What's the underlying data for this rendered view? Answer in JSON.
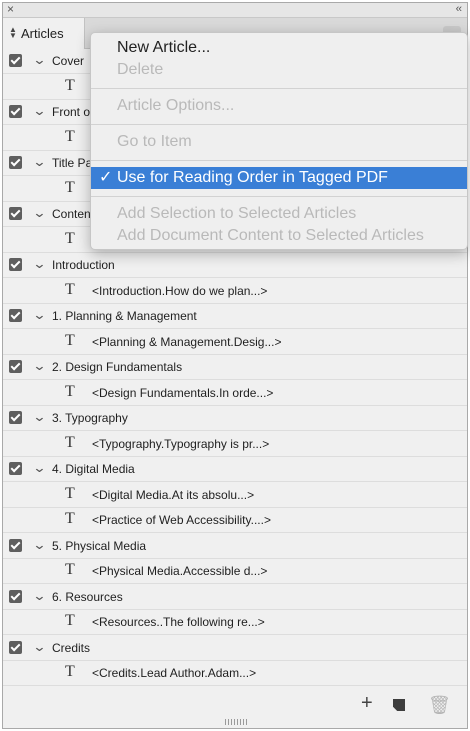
{
  "panel": {
    "tab_label": "Articles",
    "close_glyph": "×",
    "collapse_glyph": "‹‹"
  },
  "articles": [
    {
      "name": "Cover",
      "checked": true,
      "stories": [
        ""
      ]
    },
    {
      "name": "Front o",
      "checked": true,
      "stories": [
        ""
      ]
    },
    {
      "name": "Title Pa",
      "checked": true,
      "stories": [
        ""
      ]
    },
    {
      "name": "Conten",
      "checked": true,
      "stories": [
        ""
      ]
    },
    {
      "name": "Introduction",
      "checked": true,
      "stories": [
        "<Introduction.How do we plan...>"
      ]
    },
    {
      "name": "1. Planning & Management",
      "checked": true,
      "stories": [
        "<Planning & Management.Desig...>"
      ]
    },
    {
      "name": "2. Design Fundamentals",
      "checked": true,
      "stories": [
        "<Design Fundamentals.In orde...>"
      ]
    },
    {
      "name": "3. Typography",
      "checked": true,
      "stories": [
        "<Typography.Typography is pr...>"
      ]
    },
    {
      "name": "4. Digital Media",
      "checked": true,
      "stories": [
        "<Digital Media.At its absolu...>",
        "<Practice of Web Accessibility....>"
      ]
    },
    {
      "name": "5. Physical Media",
      "checked": true,
      "stories": [
        "<Physical Media.Accessible d...>"
      ]
    },
    {
      "name": "6. Resources",
      "checked": true,
      "stories": [
        "<Resources..The following re...>"
      ]
    },
    {
      "name": "Credits",
      "checked": true,
      "stories": [
        "<Credits.Lead Author.Adam...>"
      ]
    }
  ],
  "menu": {
    "new_article": "New Article...",
    "delete": "Delete",
    "article_options": "Article Options...",
    "go_to_item": "Go to Item",
    "use_reading_order": "Use for Reading Order in Tagged PDF",
    "check_glyph": "✓",
    "add_selection": "Add Selection to Selected Articles",
    "add_document": "Add Document Content to Selected Articles"
  },
  "bottom_bar": {
    "new_article_glyph": "+",
    "trash_glyph": "🗑"
  },
  "icons": {
    "story": "T",
    "chevron": "⌄"
  },
  "colors": {
    "highlight": "#3a7fd6",
    "checkbox": "#5f5f5f",
    "disabled_text": "#b9b9b9"
  }
}
